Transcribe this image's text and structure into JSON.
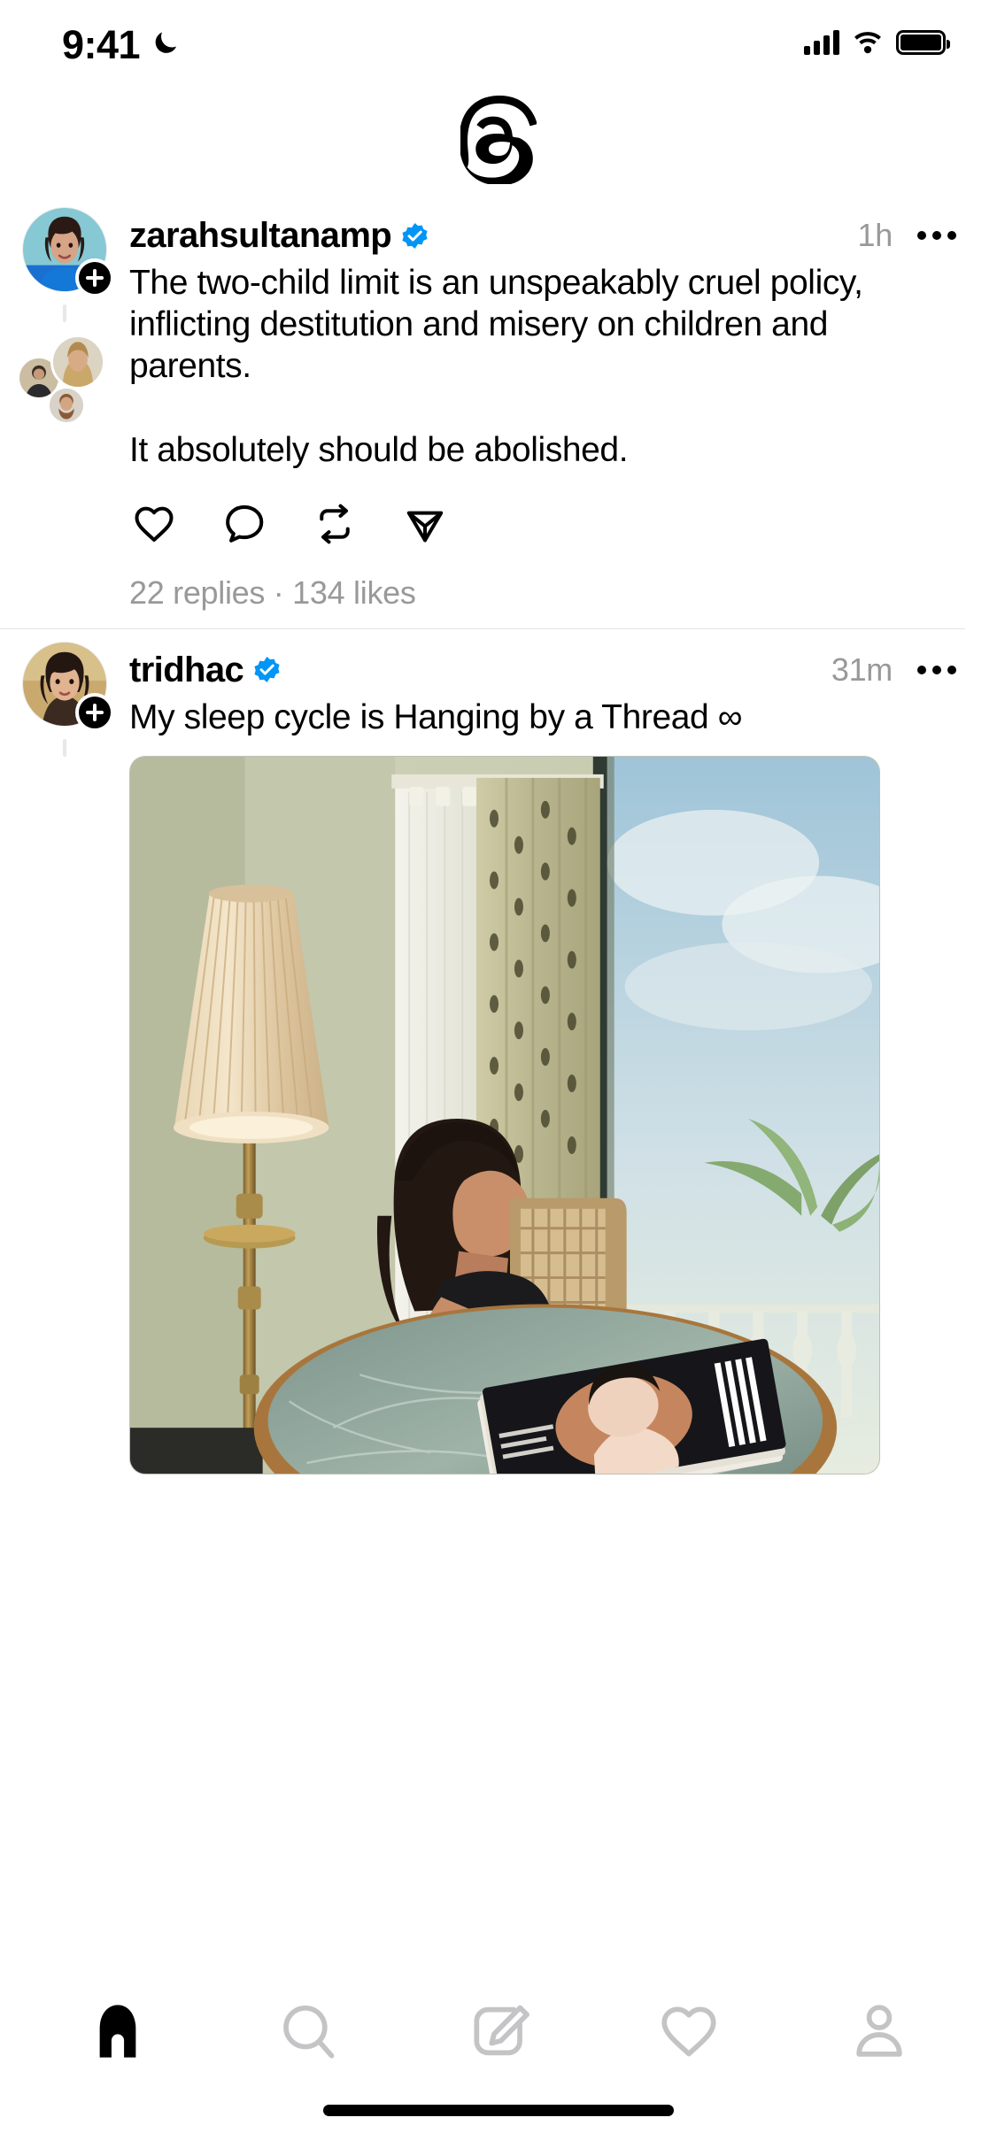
{
  "status_bar": {
    "time": "9:41",
    "dnd_icon": "moon-icon",
    "cellular_icon": "signal-bars-icon",
    "wifi_icon": "wifi-icon",
    "battery_icon": "battery-icon"
  },
  "header": {
    "logo": "threads-logo",
    "app_name": "Threads"
  },
  "feed": {
    "posts": [
      {
        "username": "zarahsultanamp",
        "verified": true,
        "timestamp": "1h",
        "more_label": "More options",
        "text": "The two-child limit is an unspeakably cruel policy, inflicting destitution and misery on children and parents.\n\nIt absolutely should be abolished.",
        "actions": {
          "like": "heart-icon",
          "reply": "comment-icon",
          "repost": "repost-icon",
          "share": "share-icon"
        },
        "meta": "22 replies · 134 likes",
        "replies_count": "22 replies",
        "likes_count": "134 likes",
        "has_attachment": false,
        "facepile_count": 3
      },
      {
        "username": "tridhac",
        "verified": true,
        "timestamp": "31m",
        "more_label": "More options",
        "text": "My sleep cycle is Hanging by a Thread ∞",
        "has_attachment": true,
        "attachment_alt": "Woman reclining on a cane chair by a window with a floor lamp and magazine on a marble table",
        "facepile_count": 0
      }
    ]
  },
  "tab_bar": {
    "tabs": [
      {
        "name": "home",
        "icon": "home-icon",
        "active": true
      },
      {
        "name": "search",
        "icon": "search-icon",
        "active": false
      },
      {
        "name": "compose",
        "icon": "compose-icon",
        "active": false
      },
      {
        "name": "activity",
        "icon": "heart-icon",
        "active": false
      },
      {
        "name": "profile",
        "icon": "profile-icon",
        "active": false
      }
    ]
  },
  "colors": {
    "verified_blue": "#0095F6",
    "text_primary": "#000000",
    "text_secondary": "#999999",
    "divider": "#e3e3e5",
    "thread_line": "#e8e8ea",
    "tab_inactive": "#c4c4c6",
    "background": "#ffffff"
  }
}
